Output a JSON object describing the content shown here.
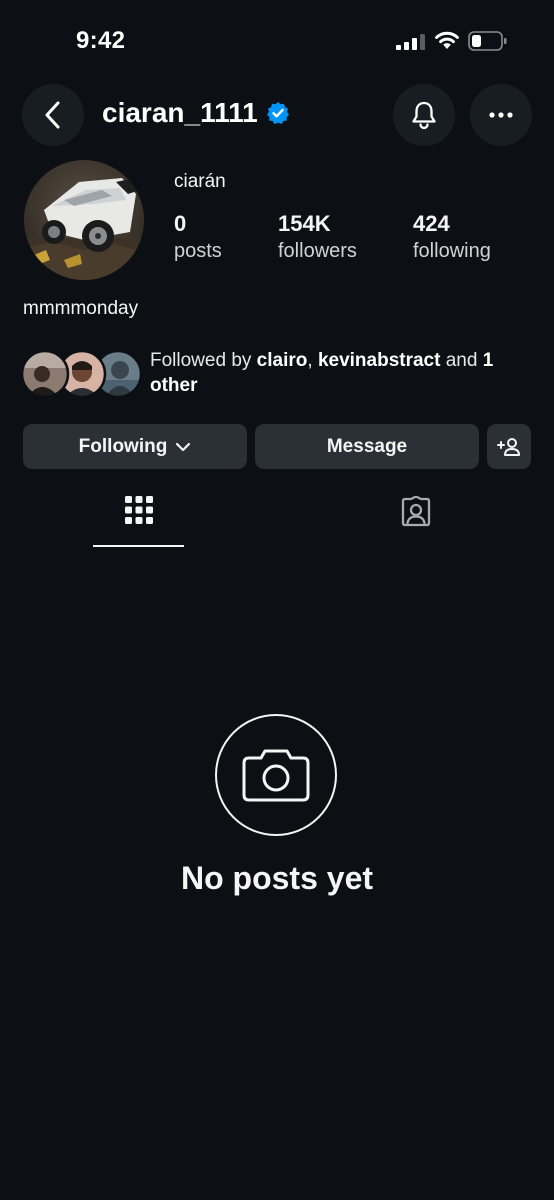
{
  "status_bar": {
    "time": "9:42",
    "icons": [
      "cellular-signal-icon",
      "wifi-icon",
      "battery-icon"
    ]
  },
  "header": {
    "username": "ciaran_1111",
    "verified": true,
    "icons": [
      "back-chevron-icon",
      "verified-badge-icon",
      "bell-icon",
      "more-horizontal-icon"
    ]
  },
  "profile": {
    "display_name": "ciarán",
    "stats": [
      {
        "value": "0",
        "label": "posts"
      },
      {
        "value": "154K",
        "label": "followers"
      },
      {
        "value": "424",
        "label": "following"
      }
    ],
    "bio": "mmmmonday",
    "followed_by": {
      "prefix": "Followed by ",
      "user1": "clairo",
      "sep": ", ",
      "user2": "kevinabstract",
      "mid": " and ",
      "count": "1",
      "suffix": "other"
    }
  },
  "actions": {
    "following_label": "Following",
    "message_label": "Message"
  },
  "tabs": [
    "grid-icon",
    "tagged-icon"
  ],
  "empty_state": {
    "title": "No posts yet",
    "icon": "camera-icon"
  },
  "colors": {
    "background": "#0c1014",
    "button": "#2b3036",
    "verified": "#0095f6"
  }
}
